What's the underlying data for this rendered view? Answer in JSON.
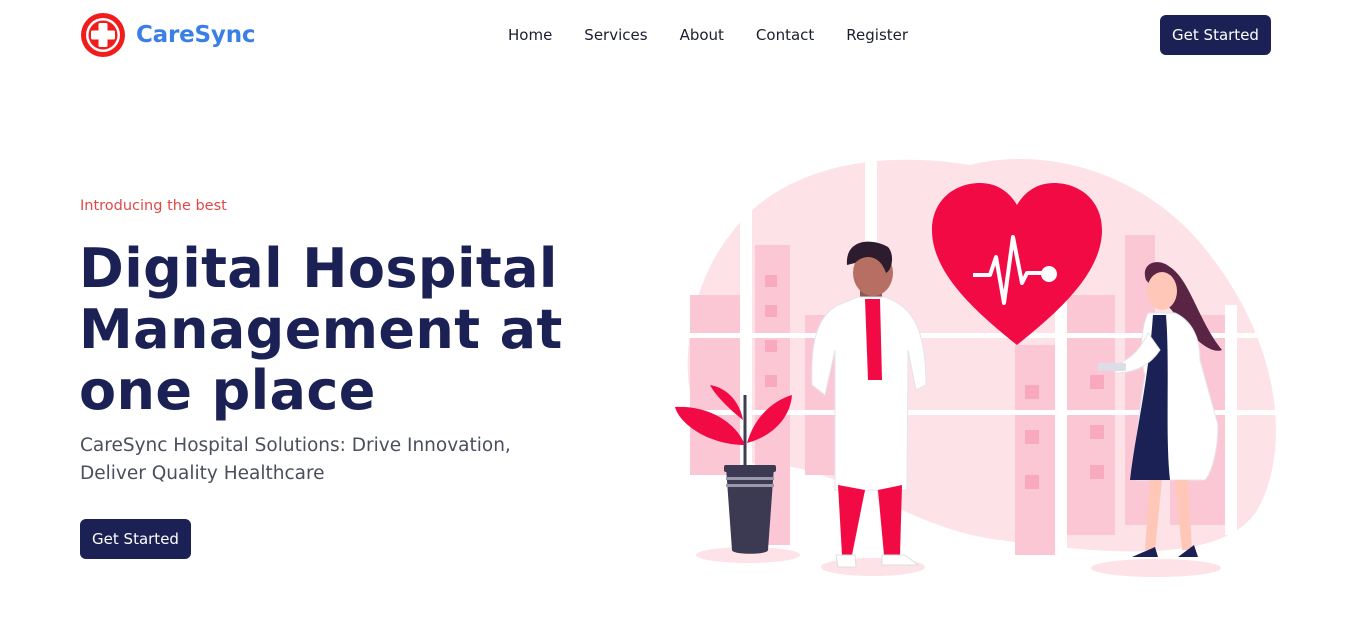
{
  "brand": {
    "name": "CareSync",
    "logo_icon": "medical-cross-icon",
    "colors": {
      "brand_blue": "#3b7fe6",
      "logo_red": "#f11d1d",
      "navy": "#1b2155",
      "accent_red": "#e04848",
      "heart_red": "#f20a45"
    }
  },
  "nav": {
    "items": [
      {
        "label": "Home"
      },
      {
        "label": "Services"
      },
      {
        "label": "About"
      },
      {
        "label": "Contact"
      },
      {
        "label": "Register"
      }
    ],
    "cta_label": "Get Started"
  },
  "hero": {
    "eyebrow": "Introducing the best",
    "headline": "Digital Hospital Management at one place",
    "subtitle": "CareSync Hospital Solutions: Drive Innovation, Deliver Quality Healthcare",
    "cta_label": "Get Started",
    "illustration": "doctors-with-heart-illustration"
  }
}
